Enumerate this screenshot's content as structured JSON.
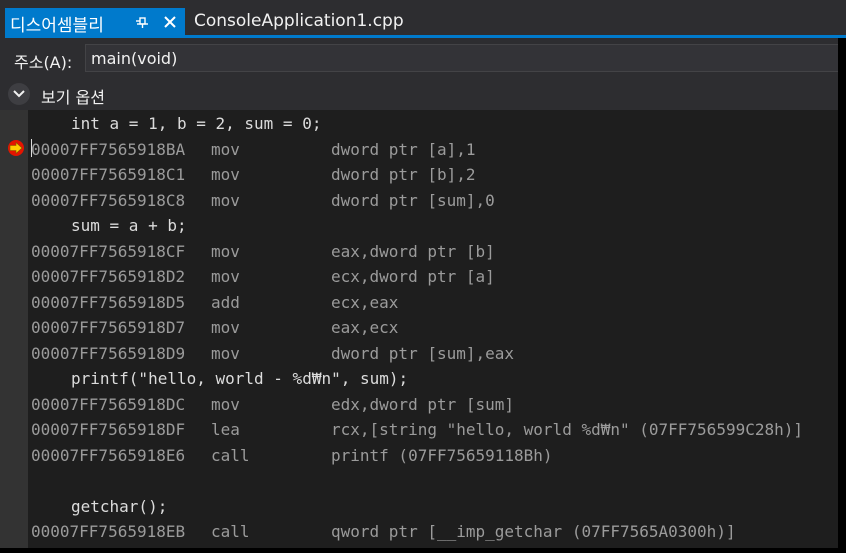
{
  "tabs": {
    "active": {
      "label": "디스어셈블리",
      "icons": [
        "pin-icon",
        "close-icon"
      ]
    },
    "inactive": {
      "label": "ConsoleApplication1.cpp"
    }
  },
  "address": {
    "label": "주소(A):",
    "value": "main(void)"
  },
  "view_options": {
    "label": "보기 옵션",
    "icon": "chevron-down-icon"
  },
  "colors": {
    "accent": "#007acc",
    "source_text": "#dcdcdc",
    "disasm_text": "#9b9b9b",
    "breakpoint": "#e51400"
  },
  "code": {
    "lines": [
      {
        "type": "source",
        "text": "int a = 1, b = 2, sum = 0;"
      },
      {
        "type": "asm",
        "address": "00007FF7565918BA",
        "op": "mov",
        "args": "dword ptr [a],1",
        "breakpoint": true
      },
      {
        "type": "asm",
        "address": "00007FF7565918C1",
        "op": "mov",
        "args": "dword ptr [b],2"
      },
      {
        "type": "asm",
        "address": "00007FF7565918C8",
        "op": "mov",
        "args": "dword ptr [sum],0"
      },
      {
        "type": "source",
        "text": "sum = a + b;"
      },
      {
        "type": "asm",
        "address": "00007FF7565918CF",
        "op": "mov",
        "args": "eax,dword ptr [b]"
      },
      {
        "type": "asm",
        "address": "00007FF7565918D2",
        "op": "mov",
        "args": "ecx,dword ptr [a]"
      },
      {
        "type": "asm",
        "address": "00007FF7565918D5",
        "op": "add",
        "args": "ecx,eax"
      },
      {
        "type": "asm",
        "address": "00007FF7565918D7",
        "op": "mov",
        "args": "eax,ecx"
      },
      {
        "type": "asm",
        "address": "00007FF7565918D9",
        "op": "mov",
        "args": "dword ptr [sum],eax"
      },
      {
        "type": "source",
        "text": "printf(\"hello, world - %d₩n\", sum);"
      },
      {
        "type": "asm",
        "address": "00007FF7565918DC",
        "op": "mov",
        "args": "edx,dword ptr [sum]"
      },
      {
        "type": "asm",
        "address": "00007FF7565918DF",
        "op": "lea",
        "args": "rcx,[string \"hello, world %d₩n\" (07FF756599C28h)]"
      },
      {
        "type": "asm",
        "address": "00007FF7565918E6",
        "op": "call",
        "args": "printf (07FF75659118Bh)"
      },
      {
        "type": "blank"
      },
      {
        "type": "source",
        "text": "getchar();"
      },
      {
        "type": "asm",
        "address": "00007FF7565918EB",
        "op": "call",
        "args": "qword ptr [__imp_getchar (07FF7565A0300h)]"
      }
    ]
  }
}
